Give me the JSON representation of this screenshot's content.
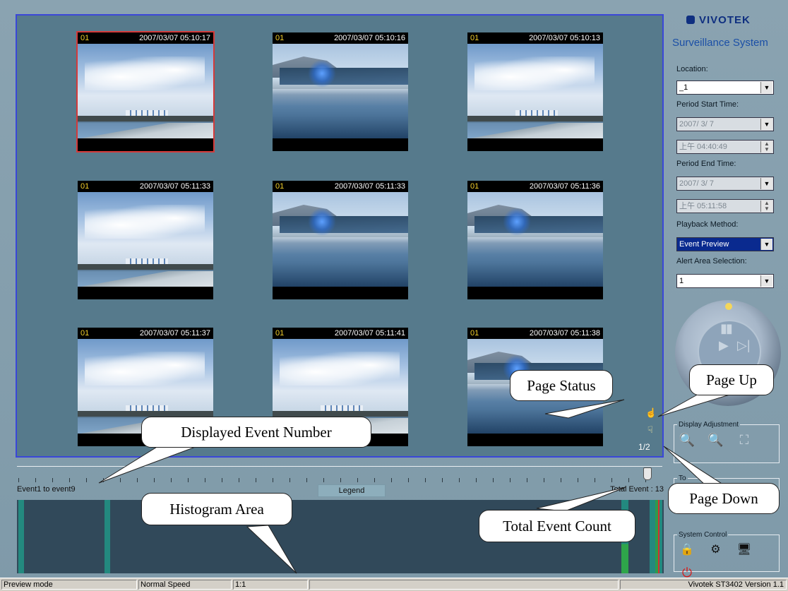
{
  "tiles": [
    {
      "channel": "01",
      "timestamp": "2007/03/07 05:10:17",
      "scene": "sky"
    },
    {
      "channel": "01",
      "timestamp": "2007/03/07 05:10:16",
      "scene": "harbor"
    },
    {
      "channel": "01",
      "timestamp": "2007/03/07 05:10:13",
      "scene": "sky"
    },
    {
      "channel": "01",
      "timestamp": "2007/03/07 05:11:33",
      "scene": "sky"
    },
    {
      "channel": "01",
      "timestamp": "2007/03/07 05:11:33",
      "scene": "harbor"
    },
    {
      "channel": "01",
      "timestamp": "2007/03/07 05:11:36",
      "scene": "harbor"
    },
    {
      "channel": "01",
      "timestamp": "2007/03/07 05:11:37",
      "scene": "sky"
    },
    {
      "channel": "01",
      "timestamp": "2007/03/07 05:11:41",
      "scene": "sky"
    },
    {
      "channel": "01",
      "timestamp": "2007/03/07 05:11:38",
      "scene": "harbor"
    }
  ],
  "page": {
    "status": "1/2",
    "up_icon": "hand-up-icon",
    "down_icon": "hand-down-icon"
  },
  "timeline": {
    "range_label": "Event1 to event9",
    "legend_label": "Legend",
    "total_label": "Total Event : 13"
  },
  "brand": {
    "logo": "VIVOTEK",
    "system_title": "Surveillance System"
  },
  "controls": {
    "location_label": "Location:",
    "location_value": "_1",
    "start_label": "Period Start Time:",
    "start_date": "2007/ 3/ 7",
    "start_time": "上午 04:40:49",
    "end_label": "Period End Time:",
    "end_date": "2007/ 3/ 7",
    "end_time": "上午 05:11:58",
    "method_label": "Playback Method:",
    "method_value": "Event Preview",
    "alert_label": "Alert Area Selection:",
    "alert_value": "1"
  },
  "display_adjustment": {
    "label": "Display Adjustment"
  },
  "tool": {
    "label": "To"
  },
  "system_control": {
    "label": "System Control"
  },
  "callouts": {
    "page_status": "Page Status",
    "page_up": "Page Up",
    "page_down": "Page Down",
    "displayed_event": "Displayed Event Number",
    "histogram": "Histogram Area",
    "total_count": "Total Event Count"
  },
  "statusbar": {
    "mode": "Preview mode",
    "speed": "Normal Speed",
    "ratio": "1:1",
    "version": "Vivotek ST3402   Version 1.1"
  }
}
